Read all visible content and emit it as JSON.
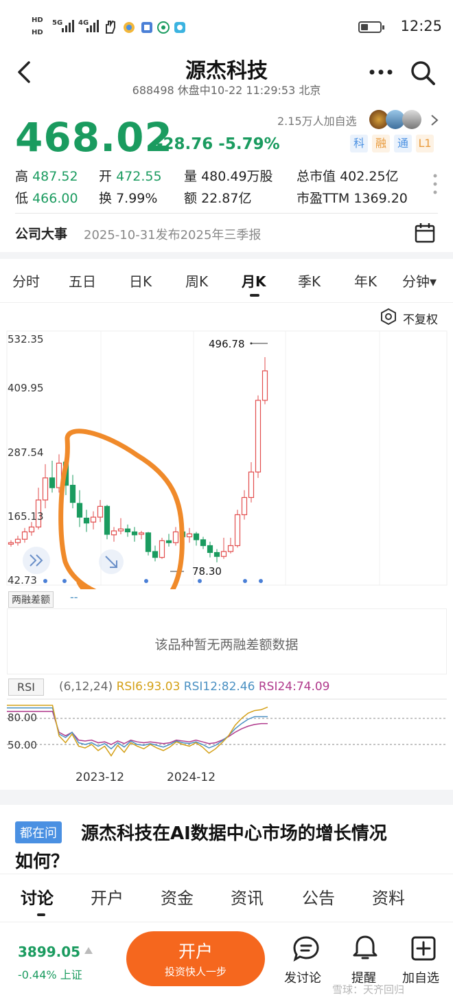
{
  "status_bar": {
    "time": "12:25",
    "network": [
      "HD",
      "HD",
      "5G",
      "4G"
    ]
  },
  "header": {
    "title": "源杰科技",
    "subtitle": "688498 休盘中10-22 11:29:53 北京"
  },
  "quote": {
    "price": "468.02",
    "change": "-28.76 -5.79%",
    "followers": "2.15万人加自选",
    "tags": [
      {
        "label": "科",
        "color": "#4a90e2"
      },
      {
        "label": "融",
        "color": "#e89a3c"
      },
      {
        "label": "通",
        "color": "#4a90e2"
      },
      {
        "label": "L1",
        "color": "#e89a3c"
      }
    ],
    "stats_row1": [
      {
        "label": "高",
        "value": "487.52"
      },
      {
        "label": "开",
        "value": "472.55"
      },
      {
        "label": "量",
        "value": "480.49万股"
      },
      {
        "label": "总市值",
        "value": "402.25亿"
      }
    ],
    "stats_row2": [
      {
        "label": "低",
        "value": "466.00"
      },
      {
        "label": "换",
        "value": "7.99%"
      },
      {
        "label": "额",
        "value": "22.87亿"
      },
      {
        "label": "市盈TTM",
        "value": "1369.20"
      }
    ]
  },
  "event": {
    "label": "公司大事",
    "text": "2025-10-31发布2025年三季报"
  },
  "period_tabs": [
    "分时",
    "五日",
    "日K",
    "周K",
    "月K",
    "季K",
    "年K",
    "分钟▾"
  ],
  "active_tab": "月K",
  "chart_header": {
    "adjust": "不复权"
  },
  "chart_data": {
    "type": "candlestick",
    "y_ticks": [
      "532.35",
      "409.95",
      "287.54",
      "165.13",
      "42.73"
    ],
    "ylim": [
      42.73,
      532.35
    ],
    "high_label": "496.78",
    "low_label": "78.30",
    "x_ticks": [
      "2023-12",
      "2024-12"
    ],
    "candles": [
      {
        "o": 115,
        "c": 118,
        "h": 123,
        "l": 110
      },
      {
        "o": 118,
        "c": 125,
        "h": 132,
        "l": 112
      },
      {
        "o": 125,
        "c": 140,
        "h": 148,
        "l": 118
      },
      {
        "o": 140,
        "c": 150,
        "h": 160,
        "l": 132
      },
      {
        "o": 150,
        "c": 205,
        "h": 230,
        "l": 145
      },
      {
        "o": 205,
        "c": 250,
        "h": 278,
        "l": 188
      },
      {
        "o": 250,
        "c": 230,
        "h": 285,
        "l": 220
      },
      {
        "o": 230,
        "c": 280,
        "h": 298,
        "l": 220
      },
      {
        "o": 282,
        "c": 235,
        "h": 320,
        "l": 215
      },
      {
        "o": 235,
        "c": 200,
        "h": 256,
        "l": 188
      },
      {
        "o": 198,
        "c": 170,
        "h": 225,
        "l": 150
      },
      {
        "o": 168,
        "c": 158,
        "h": 185,
        "l": 140
      },
      {
        "o": 160,
        "c": 170,
        "h": 182,
        "l": 145
      },
      {
        "o": 170,
        "c": 192,
        "h": 205,
        "l": 160
      },
      {
        "o": 192,
        "c": 135,
        "h": 195,
        "l": 125
      },
      {
        "o": 134,
        "c": 142,
        "h": 150,
        "l": 120
      },
      {
        "o": 142,
        "c": 146,
        "h": 168,
        "l": 135
      },
      {
        "o": 146,
        "c": 140,
        "h": 155,
        "l": 130
      },
      {
        "o": 140,
        "c": 134,
        "h": 150,
        "l": 120
      },
      {
        "o": 135,
        "c": 138,
        "h": 142,
        "l": 125
      },
      {
        "o": 138,
        "c": 100,
        "h": 140,
        "l": 92
      },
      {
        "o": 100,
        "c": 88,
        "h": 112,
        "l": 80
      },
      {
        "o": 88,
        "c": 122,
        "h": 128,
        "l": 85
      },
      {
        "o": 122,
        "c": 118,
        "h": 136,
        "l": 110
      },
      {
        "o": 118,
        "c": 140,
        "h": 150,
        "l": 112
      },
      {
        "o": 140,
        "c": 130,
        "h": 142,
        "l": 115
      },
      {
        "o": 130,
        "c": 136,
        "h": 148,
        "l": 118
      },
      {
        "o": 136,
        "c": 124,
        "h": 140,
        "l": 112
      },
      {
        "o": 124,
        "c": 112,
        "h": 130,
        "l": 105
      },
      {
        "o": 112,
        "c": 98,
        "h": 120,
        "l": 88
      },
      {
        "o": 98,
        "c": 90,
        "h": 105,
        "l": 78
      },
      {
        "o": 90,
        "c": 100,
        "h": 128,
        "l": 85
      },
      {
        "o": 100,
        "c": 112,
        "h": 128,
        "l": 96
      },
      {
        "o": 112,
        "c": 175,
        "h": 185,
        "l": 108
      },
      {
        "o": 175,
        "c": 210,
        "h": 225,
        "l": 165
      },
      {
        "o": 210,
        "c": 262,
        "h": 282,
        "l": 200
      },
      {
        "o": 262,
        "c": 408,
        "h": 418,
        "l": 250
      },
      {
        "o": 408,
        "c": 468,
        "h": 496,
        "l": 400
      }
    ]
  },
  "margin_panel": {
    "label": "两融差额",
    "dash": "--",
    "empty": "该品种暂无两融差额数据"
  },
  "rsi": {
    "label": "RSI",
    "params": "(6,12,24)",
    "rsi6": "RSI6:93.03",
    "rsi12": "RSI12:82.46",
    "rsi24": "RSI24:74.09",
    "lines": [
      "80.00",
      "50.00"
    ],
    "colors": {
      "rsi6": "#d4a017",
      "rsi12": "#4a90c2",
      "rsi24": "#b03a8c"
    }
  },
  "question": {
    "badge": "都在问",
    "text1": "源杰科技在AI数据中心市场的增长情况",
    "text2": "如何？"
  },
  "bottom_tabs": [
    "讨论",
    "开户",
    "资金",
    "资讯",
    "公告",
    "资料"
  ],
  "footer": {
    "index_value": "3899.05",
    "index_change": "-0.44% 上证",
    "open_account": "开户",
    "open_sub": "投资快人一步",
    "discuss": "发讨论",
    "remind": "提醒",
    "add_fav": "加自选",
    "watermark": "雪球：天齐回归"
  }
}
